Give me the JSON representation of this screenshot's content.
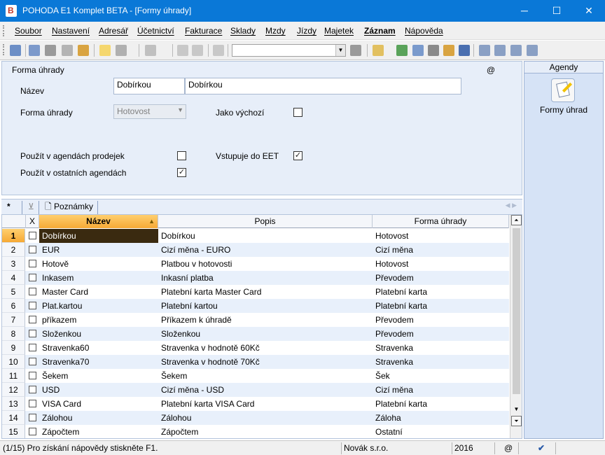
{
  "window": {
    "title": "POHODA E1 Komplet BETA - [Formy úhrady]",
    "minimize": "─",
    "maximize": "☐",
    "close": "✕"
  },
  "menu": [
    "Soubor",
    "Nastavení",
    "Adresář",
    "Účetnictví",
    "Fakturace",
    "Sklady",
    "Mzdy",
    "Jízdy",
    "Majetek",
    "Záznam",
    "Nápověda"
  ],
  "form": {
    "header": "Forma úhrady",
    "at_symbol": "@",
    "nazev_label": "Název",
    "nazev_value": "Dobírkou",
    "popis_value": "Dobírkou",
    "forma_uhrady_label": "Forma úhrady",
    "forma_uhrady_value": "Hotovost",
    "jako_vychozi_label": "Jako výchozí",
    "jako_vychozi_checked": false,
    "pouzit_prodejek_label": "Použít v agendách prodejek",
    "pouzit_prodejek_checked": false,
    "vstupuje_eet_label": "Vstupuje do EET",
    "vstupuje_eet_checked": true,
    "pouzit_ostatnich_label": "Použít v ostatních agendách",
    "pouzit_ostatnich_checked": true
  },
  "agenda": {
    "header": "Agendy",
    "item_label": "Formy úhrad"
  },
  "tabs": {
    "star": "*",
    "notes": "Poznámky"
  },
  "grid": {
    "columns": [
      "X",
      "Název",
      "Popis",
      "Forma úhrady"
    ],
    "rows": [
      {
        "num": "1",
        "nazev": "Dobírkou",
        "popis": "Dobírkou",
        "forma": "Hotovost"
      },
      {
        "num": "2",
        "nazev": "EUR",
        "popis": "Cizí měna - EURO",
        "forma": "Cizí měna"
      },
      {
        "num": "3",
        "nazev": "Hotově",
        "popis": "Platbou v hotovosti",
        "forma": "Hotovost"
      },
      {
        "num": "4",
        "nazev": "Inkasem",
        "popis": "Inkasní platba",
        "forma": "Převodem"
      },
      {
        "num": "5",
        "nazev": "Master Card",
        "popis": "Platební karta Master Card",
        "forma": "Platební karta"
      },
      {
        "num": "6",
        "nazev": "Plat.kartou",
        "popis": "Platební kartou",
        "forma": "Platební karta"
      },
      {
        "num": "7",
        "nazev": "příkazem",
        "popis": "Příkazem k úhradě",
        "forma": "Převodem"
      },
      {
        "num": "8",
        "nazev": "Složenkou",
        "popis": "Složenkou",
        "forma": "Převodem"
      },
      {
        "num": "9",
        "nazev": "Stravenka60",
        "popis": "Stravenka v hodnotě 60Kč",
        "forma": "Stravenka"
      },
      {
        "num": "10",
        "nazev": "Stravenka70",
        "popis": "Stravenka v hodnotě 70Kč",
        "forma": "Stravenka"
      },
      {
        "num": "11",
        "nazev": "Šekem",
        "popis": "Šekem",
        "forma": "Šek"
      },
      {
        "num": "12",
        "nazev": "USD",
        "popis": "Cizí měna - USD",
        "forma": "Cizí měna"
      },
      {
        "num": "13",
        "nazev": "VISA Card",
        "popis": "Platební karta VISA Card",
        "forma": "Platební karta"
      },
      {
        "num": "14",
        "nazev": "Zálohou",
        "popis": "Zálohou",
        "forma": "Záloha"
      },
      {
        "num": "15",
        "nazev": "Zápočtem",
        "popis": "Zápočtem",
        "forma": "Ostatní"
      }
    ]
  },
  "status": {
    "help": "(1/15) Pro získání nápovědy stiskněte F1.",
    "company": "Novák s.r.o.",
    "year": "2016",
    "at_symbol": "@"
  }
}
